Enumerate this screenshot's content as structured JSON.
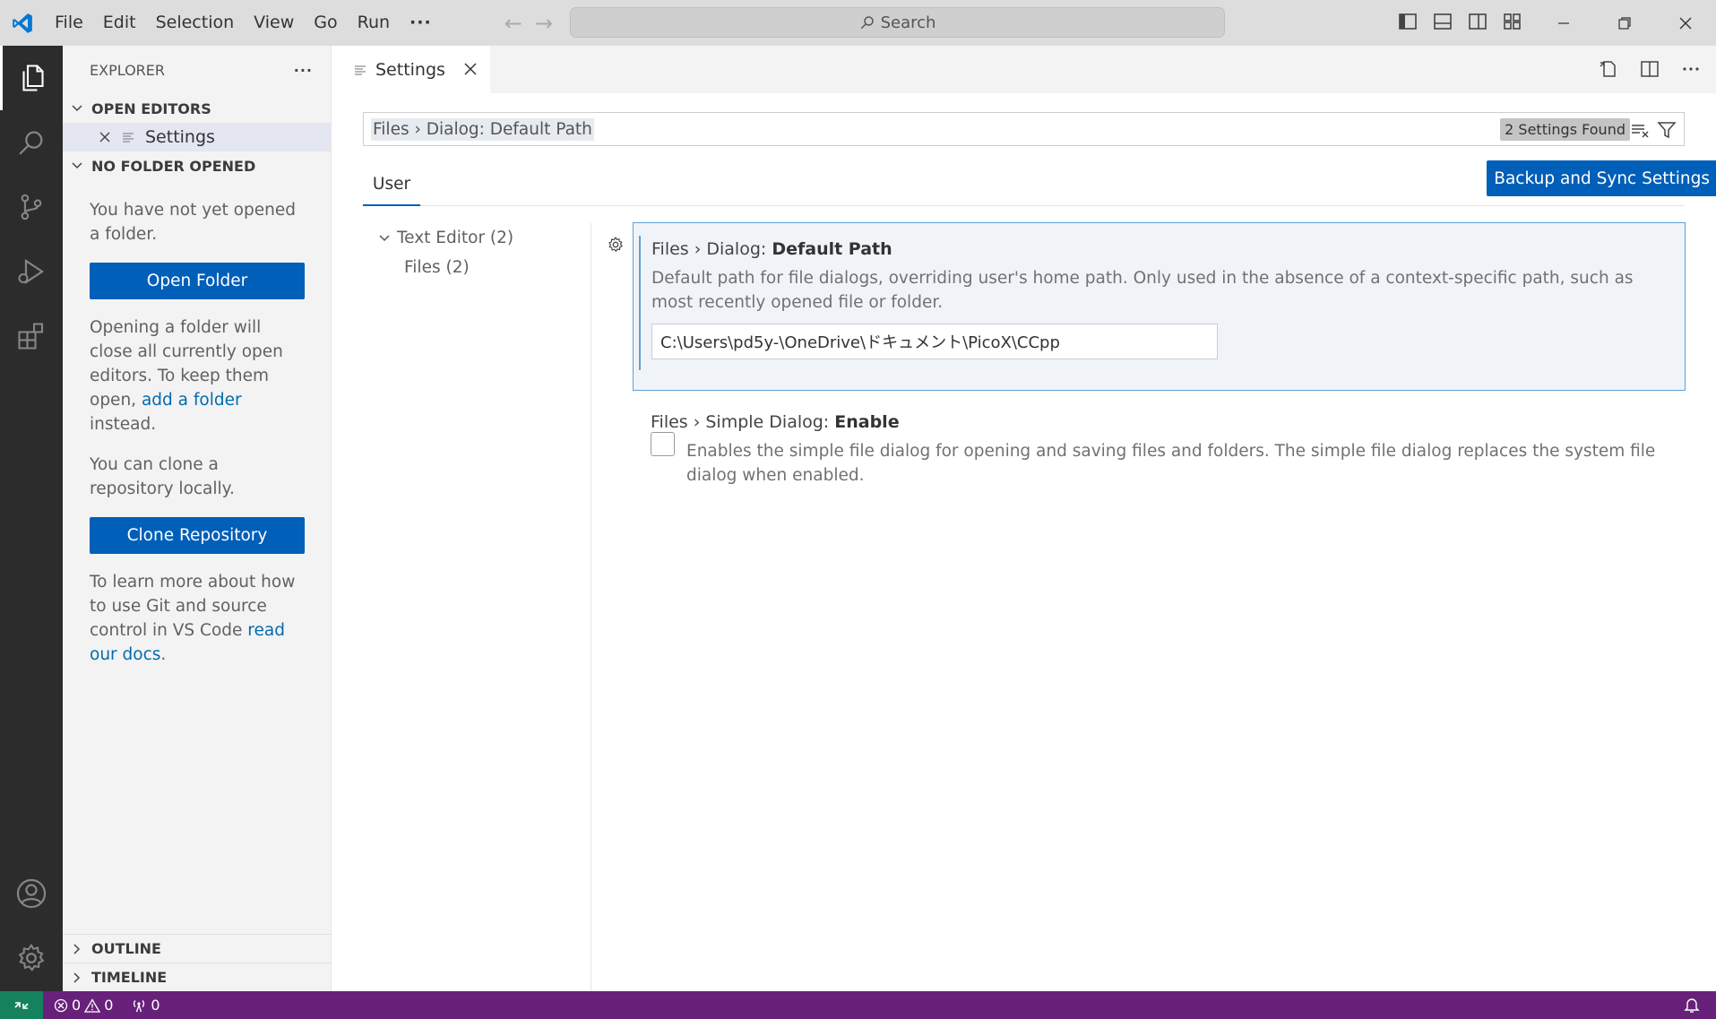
{
  "menu": {
    "items": [
      "File",
      "Edit",
      "Selection",
      "View",
      "Go",
      "Run"
    ],
    "more": "···"
  },
  "command_center": {
    "label": "Search"
  },
  "sidebar": {
    "title": "EXPLORER",
    "more": "···",
    "open_editors": "OPEN EDITORS",
    "open_editor_item": "Settings",
    "no_folder": "NO FOLDER OPENED",
    "msg1": "You have not yet opened a folder.",
    "open_folder_btn": "Open Folder",
    "msg2_a": "Opening a folder will close all currently open editors. To keep them open, ",
    "msg2_link": "add a folder",
    "msg2_b": " instead.",
    "msg3": "You can clone a repository locally.",
    "clone_btn": "Clone Repository",
    "msg4_a": "To learn more about how to use Git and source control in VS Code ",
    "msg4_link": "read our docs",
    "msg4_b": ".",
    "outline": "OUTLINE",
    "timeline": "TIMELINE"
  },
  "tab": {
    "label": "Settings"
  },
  "settings": {
    "search_value": "Files › Dialog: Default Path",
    "found": "2 Settings Found",
    "scope_user": "User",
    "sync_btn": "Backup and Sync Settings",
    "toc": [
      {
        "label": "Text Editor (2)"
      },
      {
        "label": "Files (2)"
      }
    ],
    "items": [
      {
        "category": "Files › Dialog: ",
        "name": "Default Path",
        "description": "Default path for file dialogs, overriding user's home path. Only used in the absence of a context-specific path, such as most recently opened file or folder.",
        "value": "C:\\Users\\pd5y-\\OneDrive\\ドキュメント\\PicoX\\CCpp"
      },
      {
        "category": "Files › Simple Dialog: ",
        "name": "Enable",
        "description": "Enables the simple file dialog for opening and saving files and folders. The simple file dialog replaces the system file dialog when enabled."
      }
    ]
  },
  "status": {
    "errors": "0",
    "warnings": "0",
    "ports": "0"
  },
  "colors": {
    "accent": "#005fb8",
    "statusbar": "#68217a",
    "remote": "#16825d"
  }
}
